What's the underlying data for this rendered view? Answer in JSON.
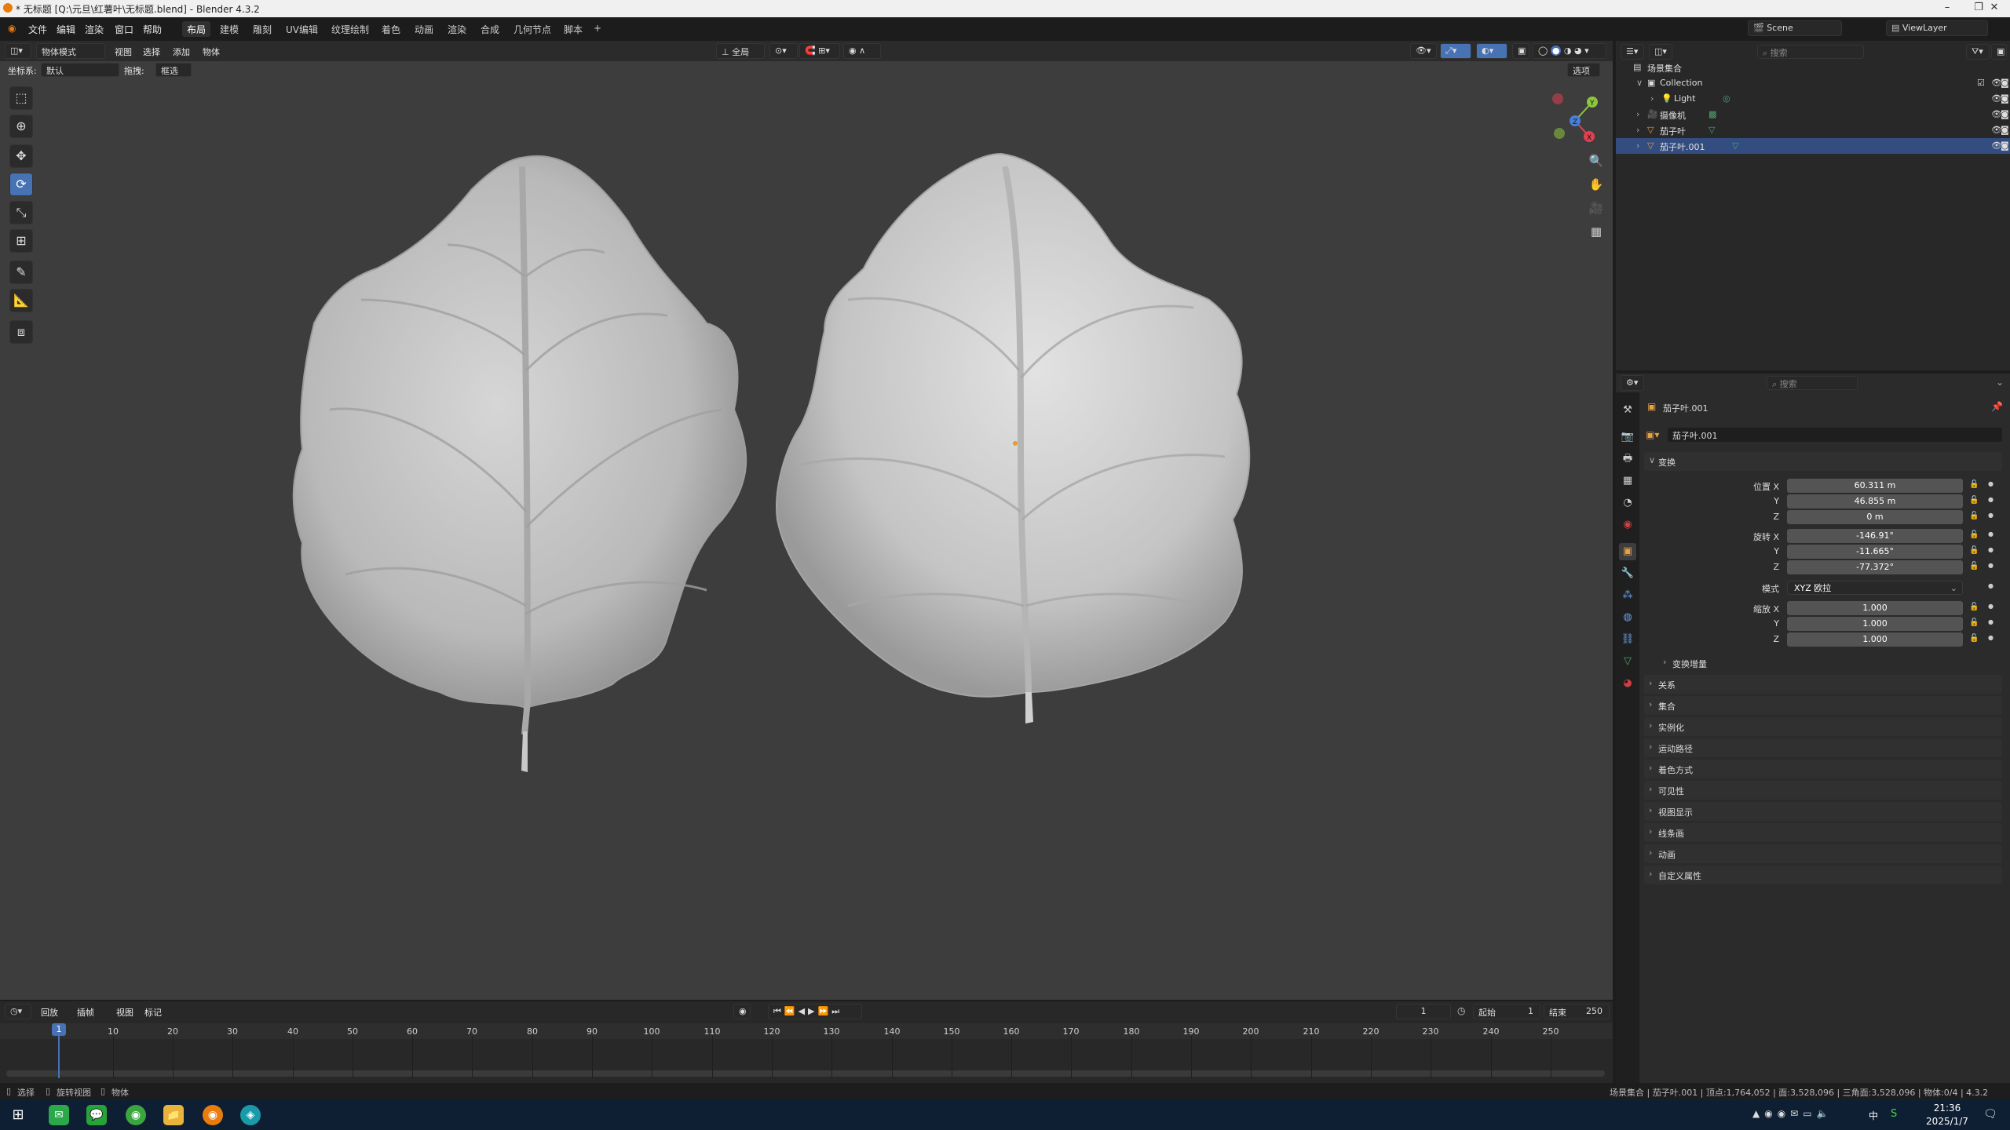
{
  "titlebar": {
    "title": "* 无标题 [Q:\\元旦\\红薯叶\\无标题.blend] - Blender 4.3.2",
    "minimize": "–",
    "maximize": "❐",
    "close": "✕"
  },
  "menu": {
    "items": [
      "文件",
      "编辑",
      "渲染",
      "窗口",
      "帮助"
    ]
  },
  "workspaces": {
    "tabs": [
      "布局",
      "建模",
      "雕刻",
      "UV编辑",
      "纹理绘制",
      "着色",
      "动画",
      "渲染",
      "合成",
      "几何节点",
      "脚本"
    ],
    "active": "布局",
    "add": "+"
  },
  "scene": {
    "label": "Scene",
    "viewlayer": "ViewLayer"
  },
  "viewport": {
    "mode": "物体模式",
    "menus": [
      "视图",
      "选择",
      "添加",
      "物体"
    ],
    "orientation_label": "坐标系:",
    "orientation_value": "默认",
    "drag_label": "拖拽:",
    "drag_value": "框选",
    "pivot": "全局",
    "options": "选项",
    "gizmo": {
      "y": "Y",
      "z": "Z",
      "x": "X"
    },
    "accent": "#4772b3"
  },
  "toolbar": {
    "tools": [
      "select-box-icon",
      "cursor-icon",
      "move-icon",
      "rotate-icon",
      "scale-icon",
      "transform-icon",
      "annotate-icon",
      "measure-icon",
      "add-cube-icon"
    ],
    "active_index": 3
  },
  "outliner": {
    "search_placeholder": "搜索",
    "root": "场景集合",
    "rows": [
      {
        "name": "Collection",
        "icon": "collection-icon",
        "depth": 1
      },
      {
        "name": "Light",
        "icon": "light-icon",
        "depth": 2
      },
      {
        "name": "摄像机",
        "icon": "camera-icon",
        "depth": 2
      },
      {
        "name": "茄子叶",
        "icon": "mesh-icon",
        "depth": 2
      },
      {
        "name": "茄子叶.001",
        "icon": "mesh-icon",
        "depth": 2
      }
    ]
  },
  "properties": {
    "search_placeholder": "搜索",
    "object_name": "茄子叶.001",
    "data_name": "茄子叶.001",
    "transform_title": "变换",
    "location": {
      "label": "位置 X",
      "x": "60.311 m",
      "y": "46.855 m",
      "z": "0 m"
    },
    "rotation": {
      "label": "旋转 X",
      "x": "-146.91°",
      "y": "-11.665°",
      "z": "-77.372°"
    },
    "mode_label": "模式",
    "mode_value": "XYZ 欧拉",
    "scale": {
      "label": "缩放 X",
      "x": "1.000",
      "y": "1.000",
      "z": "1.000"
    },
    "axis_y": "Y",
    "axis_z": "Z",
    "delta": "变换增量",
    "panels": [
      "关系",
      "集合",
      "实例化",
      "运动路径",
      "着色方式",
      "可见性",
      "视图显示",
      "线条画",
      "动画",
      "自定义属性"
    ]
  },
  "timeline": {
    "menus": [
      "回放",
      "插帧",
      "视图",
      "标记"
    ],
    "current_frame": "1",
    "start_label": "起始",
    "start": "1",
    "end_label": "结束",
    "end": "250",
    "ticks": [
      "1",
      "10",
      "20",
      "30",
      "40",
      "50",
      "60",
      "70",
      "80",
      "90",
      "100",
      "110",
      "120",
      "130",
      "140",
      "150",
      "160",
      "170",
      "180",
      "190",
      "200",
      "210",
      "220",
      "230",
      "240",
      "250"
    ]
  },
  "statusbar": {
    "left": [
      "选择",
      "旋转视图",
      "物体"
    ],
    "right": "场景集合 | 茄子叶.001 | 顶点:1,764,052 | 面:3,528,096 | 三角面:3,528,096 | 物体:0/4 | 4.3.2"
  },
  "taskbar": {
    "time": "21:36",
    "date": "2025/1/7",
    "ime": "中"
  }
}
